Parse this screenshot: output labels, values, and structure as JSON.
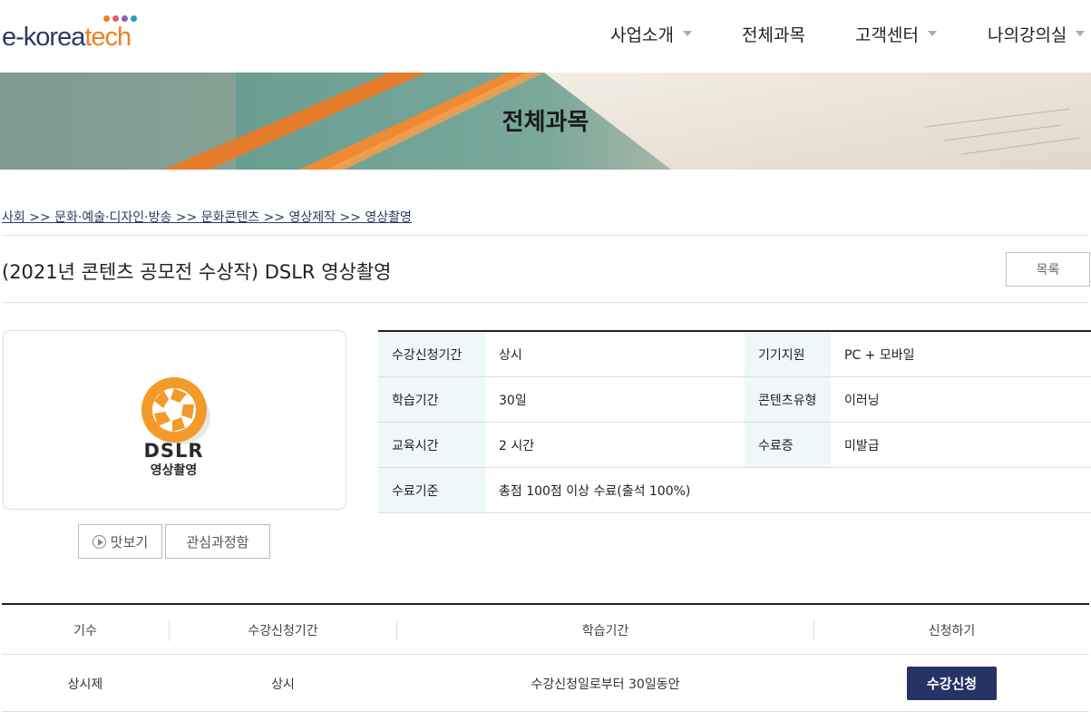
{
  "header": {
    "logo_part1": "e-korea",
    "logo_part2": "tech",
    "logo_dot_colors": [
      "#f0801f",
      "#e95b6d",
      "#8d5fb0",
      "#2a9ad0"
    ],
    "nav": [
      {
        "label": "사업소개",
        "dropdown": true
      },
      {
        "label": "전체과목",
        "dropdown": false
      },
      {
        "label": "고객센터",
        "dropdown": true
      },
      {
        "label": "나의강의실",
        "dropdown": true
      }
    ]
  },
  "banner": {
    "title": "전체과목"
  },
  "breadcrumb": "사회 >> 문화·예술·디자인·방송 >> 문화콘텐츠 >> 영상제작 >> 영상촬영",
  "course": {
    "title": "(2021년 콘텐츠 공모전 수상작) DSLR 영상촬영",
    "list_button": "목록",
    "thumbnail": {
      "title": "DSLR",
      "subtitle": "영상촬영",
      "icon": "camera-aperture-icon"
    },
    "preview_button": "맛보기",
    "favorite_button": "관심과정함"
  },
  "info": {
    "rows": [
      {
        "label1": "수강신청기간",
        "value1": "상시",
        "label2": "기기지원",
        "value2": "PC + 모바일"
      },
      {
        "label1": "학습기간",
        "value1": "30일",
        "label2": "콘텐츠유형",
        "value2": "이러닝"
      },
      {
        "label1": "교육시간",
        "value1": "2 시간",
        "label2": "수료증",
        "value2": "미발급"
      },
      {
        "label1": "수료기준",
        "value1": "총점 100점 이상 수료(출석 100%)",
        "label2": "",
        "value2": ""
      }
    ]
  },
  "schedule": {
    "headers": [
      "기수",
      "수강신청기간",
      "학습기간",
      "신청하기"
    ],
    "rows": [
      {
        "term": "상시제",
        "apply_period": "상시",
        "study_period": "수강신청일로부터 30일동안",
        "button": "수강신청"
      }
    ]
  },
  "colors": {
    "brand_navy": "#253464",
    "accent_orange": "#f0801f",
    "label_bg": "#eff7f9"
  }
}
